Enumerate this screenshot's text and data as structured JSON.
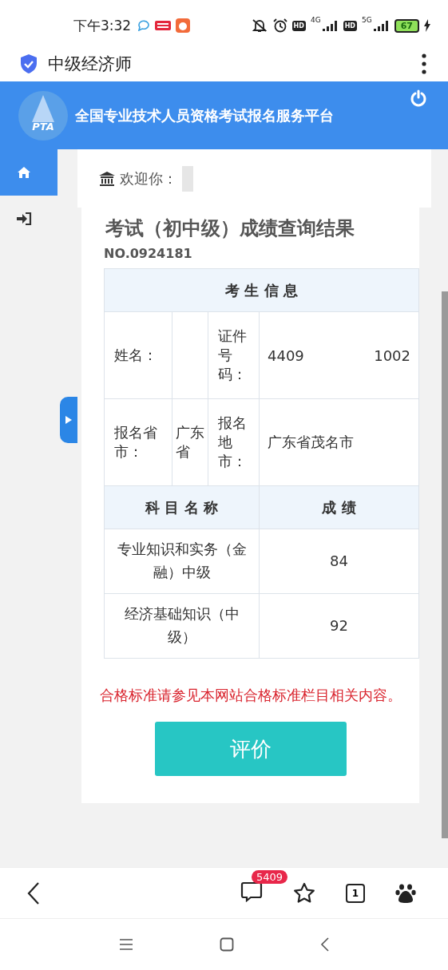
{
  "status_bar": {
    "time": "下午3:32",
    "hd_1": "HD",
    "net_1": "4G",
    "hd_2": "HD",
    "net_2": "5G",
    "battery": "67"
  },
  "browser": {
    "title": "中级经济师"
  },
  "header": {
    "title": "全国专业技术人员资格考试报名服务平台",
    "logo_text": "PTA"
  },
  "nav": [
    {
      "kind": "home",
      "selected": true
    },
    {
      "kind": "login",
      "selected": false
    }
  ],
  "welcome": {
    "label": "欢迎你："
  },
  "result": {
    "title": "考试（初中级）成绩查询结果",
    "number": "NO.0924181",
    "info_heading": "考 生 信 息",
    "rows": [
      {
        "label_1": "姓名：",
        "value_1": "",
        "label_2": "证件号码：",
        "value_2": [
          "4409",
          "1002"
        ]
      },
      {
        "label_1": "报名省市：",
        "value_1": "广东省",
        "label_2": "报名地市：",
        "value_2": [
          "广东省茂名市"
        ]
      }
    ],
    "subject_heading": "科 目 名 称",
    "score_heading": "成 绩",
    "scores": [
      {
        "subject": "专业知识和实务（金融）中级",
        "score": "84"
      },
      {
        "subject": "经济基础知识（中级）",
        "score": "92"
      }
    ],
    "note": "合格标准请参见本网站合格标准栏目相关内容。",
    "button": "评价"
  },
  "bottom_bar": {
    "badge": "5409",
    "tabs": "1"
  }
}
